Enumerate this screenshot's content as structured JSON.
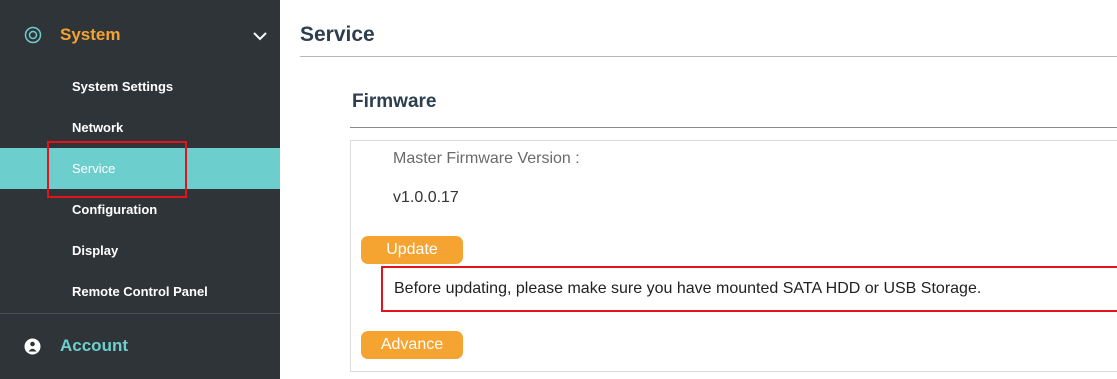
{
  "sidebar": {
    "system": {
      "title": "System",
      "icon": "gear-icon",
      "expand_icon": "chevron-down-icon"
    },
    "items": [
      {
        "label": "System Settings",
        "active": false
      },
      {
        "label": "Network",
        "active": false
      },
      {
        "label": "Service",
        "active": true
      },
      {
        "label": "Configuration",
        "active": false
      },
      {
        "label": "Display",
        "active": false
      },
      {
        "label": "Remote Control Panel",
        "active": false
      }
    ],
    "account": {
      "title": "Account",
      "icon": "person-icon"
    }
  },
  "main": {
    "page_title": "Service",
    "section_title": "Firmware",
    "firmware": {
      "label": "Master Firmware Version :",
      "version": "v1.0.0.17"
    },
    "update_button": "Update",
    "notice": "Before updating, please make sure you have mounted SATA HDD or USB Storage.",
    "advance_button": "Advance"
  },
  "colors": {
    "sidebar_bg": "#2f3439",
    "accent_orange": "#f5a331",
    "accent_teal": "#6ccfcd",
    "highlight_red": "#e3131b"
  }
}
